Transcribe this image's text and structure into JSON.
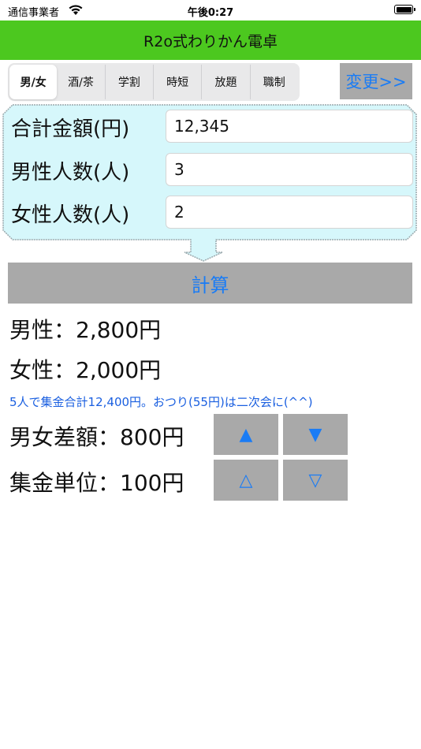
{
  "status_bar": {
    "carrier": "通信事業者",
    "time": "午後0:27"
  },
  "app": {
    "title": "R2o式わりかん電卓"
  },
  "tabs": [
    {
      "label": "男/女",
      "selected": true
    },
    {
      "label": "酒/茶",
      "selected": false
    },
    {
      "label": "学割",
      "selected": false
    },
    {
      "label": "時短",
      "selected": false
    },
    {
      "label": "放題",
      "selected": false
    },
    {
      "label": "職制",
      "selected": false
    }
  ],
  "change_button": "変更>>",
  "inputs": [
    {
      "label": "合計金額(円)",
      "value": "12,345"
    },
    {
      "label": "男性人数(人)",
      "value": "3"
    },
    {
      "label": "女性人数(人)",
      "value": "2"
    }
  ],
  "calc_button": "計算",
  "results": {
    "male": "男性：2,800円",
    "female": "女性：2,000円",
    "note": "5人で集金合計12,400円。おつり(55円)は二次会に(^^)",
    "diff": "男女差額：800円",
    "unit": "集金単位：100円"
  },
  "controls": {
    "diff_up": "▲",
    "diff_down": "▼",
    "unit_up": "△",
    "unit_down": "▽"
  },
  "colors": {
    "title_bar": "#4cc81f",
    "accent": "#1a7cf5",
    "button_bg": "#a9a9a9",
    "bubble_bg": "#d6f7fb"
  }
}
